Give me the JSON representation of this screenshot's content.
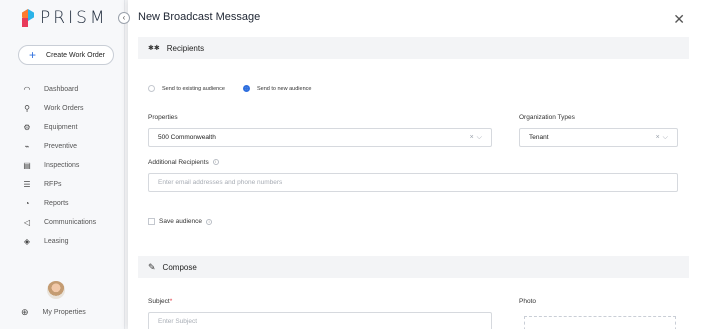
{
  "brand": {
    "name": "PRISM"
  },
  "sidebar": {
    "create_label": "Create Work Order",
    "items": [
      {
        "icon": "dashboard-icon",
        "glyph": "◠",
        "label": "Dashboard"
      },
      {
        "icon": "wrench-icon",
        "glyph": "⚲",
        "label": "Work Orders"
      },
      {
        "icon": "equipment-icon",
        "glyph": "⚙",
        "label": "Equipment"
      },
      {
        "icon": "preventive-icon",
        "glyph": "⌁",
        "label": "Preventive"
      },
      {
        "icon": "clipboard-icon",
        "glyph": "▤",
        "label": "Inspections"
      },
      {
        "icon": "list-icon",
        "glyph": "☰",
        "label": "RFPs"
      },
      {
        "icon": "reports-icon",
        "glyph": "◔",
        "label": "Reports"
      },
      {
        "icon": "megaphone-icon",
        "glyph": "◁",
        "label": "Communications"
      },
      {
        "icon": "layers-icon",
        "glyph": "◈",
        "label": "Leasing"
      }
    ],
    "footer_label": "My Properties"
  },
  "modal": {
    "title": "New Broadcast Message",
    "recipients_header": "Recipients",
    "audience_options": [
      "Send to existing audience",
      "Send to new audience"
    ],
    "audience_selected": "Send to new audience",
    "properties_label": "Properties",
    "properties_value": "500 Commonwealth",
    "org_types_label": "Organization Types",
    "org_types_value": "Tenant",
    "additional_label": "Additional Recipients",
    "additional_placeholder": "Enter email addresses and phone numbers",
    "save_audience_label": "Save audience",
    "compose_header": "Compose",
    "subject_label": "Subject",
    "subject_required_mark": "*",
    "subject_placeholder": "Enter Subject",
    "photo_label": "Photo"
  },
  "colors": {
    "accent": "#2f6fde",
    "required": "#e0303a"
  }
}
